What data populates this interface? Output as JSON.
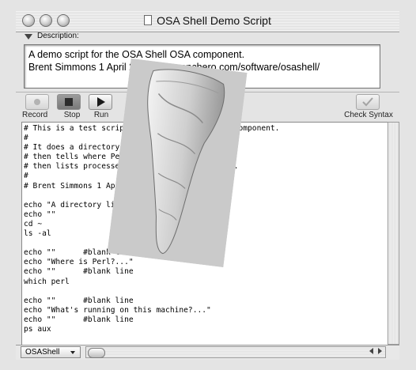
{
  "window": {
    "title": "OSA Shell Demo Script"
  },
  "description": {
    "label": "Description:",
    "line1": "A demo script for the OSA Shell OSA component.",
    "line2": "Brent Simmons 1 April 2001  www.ranchero.com/software/osashell/"
  },
  "toolbar": {
    "record_label": "Record",
    "stop_label": "Stop",
    "run_label": "Run",
    "check_syntax_label": "Check Syntax"
  },
  "editor": {
    "code": "# This is a test script for the OSA Shell OSA component.\n#\n# It does a directory listing of home,\n# then tells where Perl is,\n# then lists processes running on this machine.\n#\n# Brent Simmons 1 April 2001\n\necho \"A directory listing...\"\necho \"\"\ncd ~\nls -al\n\necho \"\"      #blank line\necho \"Where is Perl?...\"\necho \"\"      #blank line\nwhich perl\n\necho \"\"      #blank line\necho \"What's running on this machine?...\"\necho \"\"      #blank line\nps aux"
  },
  "statusbar": {
    "language": "OSAShell"
  },
  "icons": {
    "record": "record-icon",
    "stop": "stop-icon",
    "run": "run-icon",
    "check": "checkmark-icon",
    "document": "document-icon"
  }
}
